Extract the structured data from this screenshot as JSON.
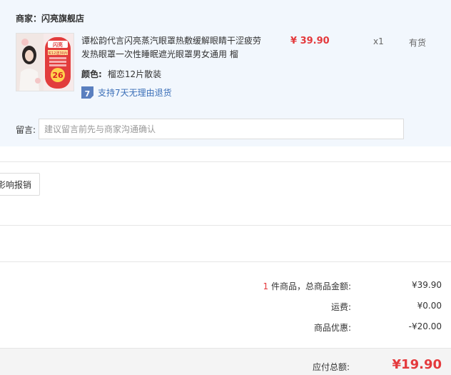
{
  "shop": {
    "label": "商家：",
    "name": "闪亮旗舰店"
  },
  "item": {
    "title": "谭松韵代言闪亮蒸汽眼罩热敷缓解眼睛干涩疲劳发热眼罩一次性睡眠遮光眼罩男女通用 榴",
    "price": "¥ 39.90",
    "quantity": "x1",
    "stock": "有货",
    "spec_key": "颜色:",
    "spec_value": "榴恋12片散装",
    "return_badge": "7",
    "return_text": "支持7天无理由退货",
    "thumb_brand": "闪亮",
    "thumb_promo": "买12送30片",
    "thumb_number": "26"
  },
  "remark": {
    "label": "留言:",
    "placeholder": "建议留言前先与商家沟通确认"
  },
  "invoice": {
    "button_label": "影响报销"
  },
  "summary": {
    "count": "1",
    "count_suffix": " 件商品，总商品金额:",
    "goods_total": "¥39.90",
    "shipping_label": "运费:",
    "shipping_value": "¥0.00",
    "discount_label": "商品优惠:",
    "discount_value": "-¥20.00"
  },
  "total": {
    "label": "应付总额:",
    "value": "¥19.90"
  },
  "colors": {
    "accent_red": "#e4393c",
    "link_blue": "#3b6fb8",
    "panel_bg": "#f2f7fd"
  }
}
